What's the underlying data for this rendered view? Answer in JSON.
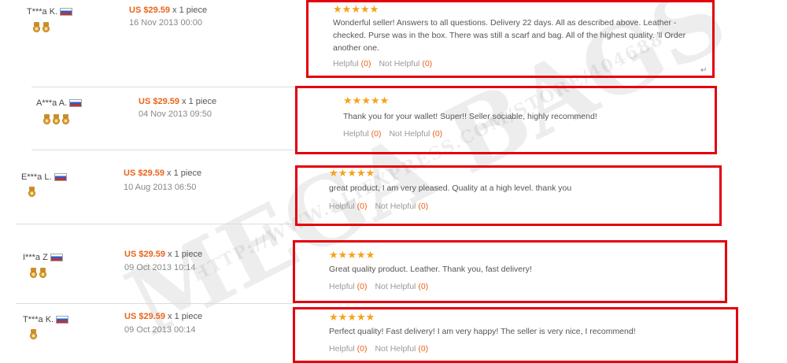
{
  "reviews": [
    {
      "buyer": "T***a K.",
      "medal_count": 2,
      "price": "US $29.59",
      "qty": "x 1 piece",
      "date": "16 Nov 2013 00:00",
      "rating": 5,
      "text": "Wonderful seller! Answers to all questions. Delivery 22 days. All as described above. Leather - checked. Purse was in the box. There was still a scarf and bag. All of the highest quality. 'll Order another one.",
      "helpful_label": "Helpful",
      "helpful_count": "(0)",
      "not_helpful_label": "Not Helpful",
      "not_helpful_count": "(0)"
    },
    {
      "buyer": "A***a A.",
      "medal_count": 3,
      "price": "US $29.59",
      "qty": "x 1 piece",
      "date": "04 Nov 2013 09:50",
      "rating": 5,
      "text": "Thank you for your wallet! Super!! Seller sociable, highly recommend!",
      "helpful_label": "Helpful",
      "helpful_count": "(0)",
      "not_helpful_label": "Not Helpful",
      "not_helpful_count": "(0)"
    },
    {
      "buyer": "E***a L.",
      "medal_count": 1,
      "price": "US $29.59",
      "qty": "x 1 piece",
      "date": "10 Aug 2013 06:50",
      "rating": 5,
      "text": "great product, I am very pleased. Quality at a high level. thank you",
      "helpful_label": "Helpful",
      "helpful_count": "(0)",
      "not_helpful_label": "Not Helpful",
      "not_helpful_count": "(0)"
    },
    {
      "buyer": "I***a Z",
      "medal_count": 2,
      "price": "US $29.59",
      "qty": "x 1 piece",
      "date": "09 Oct 2013 10:14",
      "rating": 5,
      "text": "Great quality product. Leather. Thank you, fast delivery!",
      "helpful_label": "Helpful",
      "helpful_count": "(0)",
      "not_helpful_label": "Not Helpful",
      "not_helpful_count": "(0)"
    },
    {
      "buyer": "T***a K.",
      "medal_count": 1,
      "price": "US $29.59",
      "qty": "x 1 piece",
      "date": "09 Oct 2013 00:14",
      "rating": 5,
      "text": "Perfect quality! Fast delivery! I am very happy! The seller is very nice, I recommend!",
      "helpful_label": "Helpful",
      "helpful_count": "(0)",
      "not_helpful_label": "Not Helpful",
      "not_helpful_count": "(0)"
    }
  ],
  "watermark": {
    "brand": "MEGA BAGS",
    "url": "HTTP://WWW.ALIEXPRESS.COM/STORE/404688"
  },
  "colors": {
    "highlight_border": "#e3000f",
    "price": "#e8641b",
    "star": "#f5a21b"
  },
  "icons": {
    "flag": "russia-flag-icon",
    "medal": "buyer-medal-icon",
    "star": "star-icon",
    "enter": "return-arrow-icon"
  }
}
